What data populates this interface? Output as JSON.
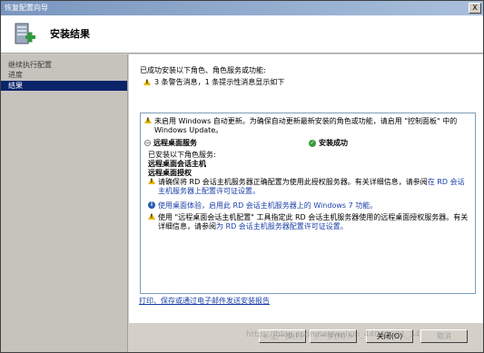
{
  "window": {
    "title": "恢复配置向导",
    "close_label": "X"
  },
  "header": {
    "title": "安装结果",
    "icon": "server-install-icon"
  },
  "sidebar": {
    "items": [
      {
        "label": "继续执行配置"
      },
      {
        "label": "进度"
      },
      {
        "label": "结果"
      }
    ]
  },
  "summary": {
    "line1": "已成功安装以下角色、角色服务或功能:",
    "line2": "3 条警告消息，1 条提示性消息显示如下"
  },
  "results": {
    "top_warning": "未启用 Windows 自动更新。为确保自动更新最新安装的角色或功能，请启用 \"控制面板\" 中的 Windows Update。",
    "section_title": "远程桌面服务",
    "section_status": "安装成功",
    "installed_intro": "已安装以下角色服务:",
    "service1": "远程桌面会话主机",
    "service2": "远程桌面授权",
    "warn2_text": "请确保将 RD 会话主机服务器正确配置为使用此授权服务器。有关详细信息，请参阅",
    "warn2_link": "在 RD 会话主机服务器上配置许可证设置。",
    "info1_link": "使用桌面体验，启用此 RD 会话主机服务器上的 Windows 7 功能。",
    "warn3_text": "使用 \"远程桌面会话主机配置\" 工具指定此 RD 会话主机服务器使用的远程桌面授权服务器。有关详细信息，请参阅",
    "warn3_link": "为 RD 会话主机服务器配置许可证设置。"
  },
  "print_link": "打印、保存或通过电子邮件发送安装报告",
  "buttons": {
    "prev": "< 上一步(P)",
    "next": "下一步(N) >",
    "close": "关闭(O)",
    "cancel": "取消"
  },
  "watermark": "https://blog.csdn.net/weixin_44041001_34"
}
